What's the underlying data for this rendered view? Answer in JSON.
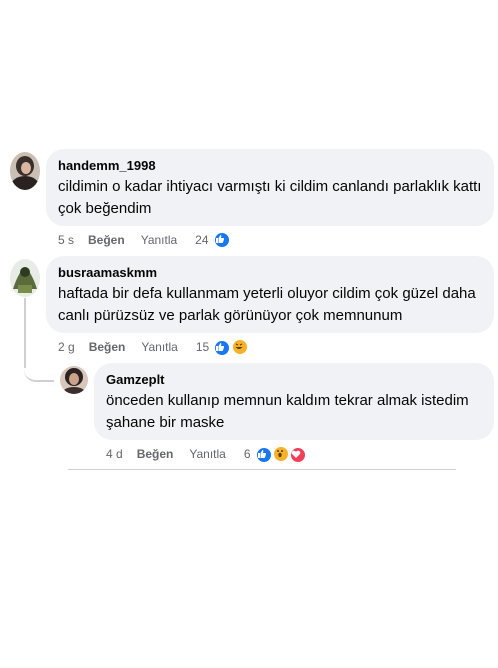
{
  "comments": [
    {
      "author": "handemm_1998",
      "text": "cildimin o kadar ihtiyacı varmıştı ki cildim canlandı parlaklık kattı çok beğendim",
      "time": "5 s",
      "like_label": "Beğen",
      "reply_label": "Yanıtla",
      "reaction_count": "24",
      "reactions": [
        "like-icon"
      ]
    },
    {
      "author": "busraamaskmm",
      "text": "haftada bir defa kullanmam yeterli oluyor cildim çok güzel daha canlı pürüzsüz ve parlak görünüyor çok memnunum",
      "time": "2 g",
      "like_label": "Beğen",
      "reply_label": "Yanıtla",
      "reaction_count": "15",
      "reactions": [
        "like-icon",
        "laugh-icon"
      ]
    },
    {
      "author": "Gamzeplt",
      "text": "önceden kullanıp memnun kaldım tekrar almak istedim şahane bir maske",
      "time": "4 d",
      "like_label": "Beğen",
      "reply_label": "Yanıtla",
      "reaction_count": "6",
      "reactions": [
        "like-icon",
        "wow-icon",
        "love-icon"
      ]
    }
  ],
  "colors": {
    "bubble": "#f0f2f5",
    "like_blue": "#1877f2",
    "laugh_yellow": "#f7b125",
    "love_red": "#f33e58",
    "meta_gray": "#65676b"
  }
}
